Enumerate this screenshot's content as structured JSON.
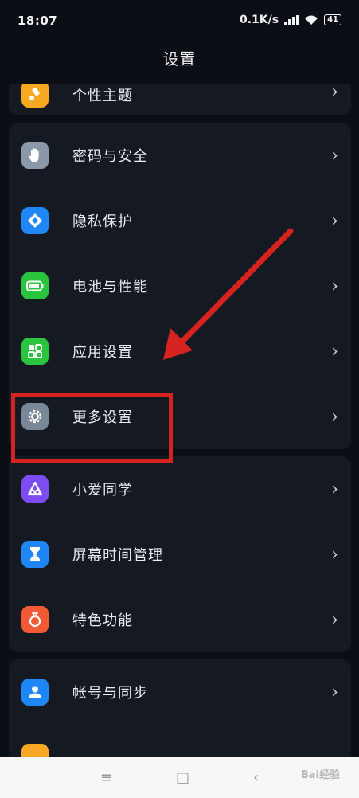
{
  "status_bar": {
    "time": "18:07",
    "speed": "0.1K/s",
    "battery": "41"
  },
  "title": "设置",
  "groups": [
    {
      "items": [
        {
          "label": "个性主题",
          "icon": "paintbrush-icon",
          "color": "#f7a823"
        }
      ]
    },
    {
      "items": [
        {
          "label": "密码与安全",
          "icon": "hand-icon",
          "color": "#8a98a8"
        },
        {
          "label": "隐私保护",
          "icon": "privacy-icon",
          "color": "#1e86f5"
        },
        {
          "label": "电池与性能",
          "icon": "battery-icon",
          "color": "#2bc43f"
        },
        {
          "label": "应用设置",
          "icon": "apps-grid-icon",
          "color": "#2bc43f"
        },
        {
          "label": "更多设置",
          "icon": "gear-icon",
          "color": "#7a8797"
        }
      ]
    },
    {
      "items": [
        {
          "label": "小爱同学",
          "icon": "xiaoai-icon",
          "color": "#7d4cf2"
        },
        {
          "label": "屏幕时间管理",
          "icon": "hourglass-icon",
          "color": "#1e86f5"
        },
        {
          "label": "特色功能",
          "icon": "ring-icon",
          "color": "#f25a35"
        }
      ]
    },
    {
      "items": [
        {
          "label": "帐号与同步",
          "icon": "user-icon",
          "color": "#1e86f5"
        }
      ]
    }
  ],
  "chevron": "›",
  "navbar": {
    "menu": "≡",
    "home": "□",
    "back": "‹"
  },
  "watermark": "Bai经验"
}
